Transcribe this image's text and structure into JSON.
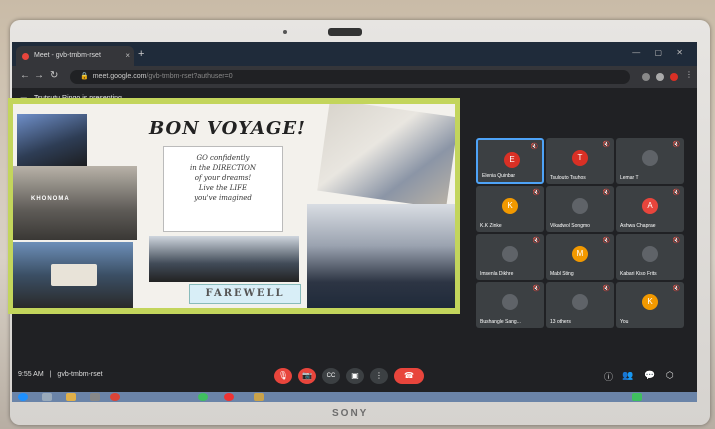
{
  "browser": {
    "tab_title": "Meet - gvb-tmbm-rset",
    "tab_close": "×",
    "new_tab": "+",
    "url": "meet.google.com",
    "url_path": "/gvb-tmbm-rset?authuser=0",
    "window_controls": "— ▢ ✕"
  },
  "presenting_banner": "Tsutsutu Ringo is presenting",
  "slide": {
    "title": "BON VOYAGE!",
    "quote_line1": "GO confidently",
    "quote_line2": "in the DIRECTION",
    "quote_line3": "of your dreams!",
    "quote_line4": "Live the LIFE",
    "quote_line5": "you've imagined",
    "sign_text": "KHONOMA",
    "farewell": "FAREWELL"
  },
  "participants": [
    {
      "name": "Elenia Quinbar",
      "initial": "E",
      "color": "#d93025",
      "active": true
    },
    {
      "name": "Tsulouto Tsuhos",
      "initial": "T",
      "color": "#d93025",
      "active": false
    },
    {
      "name": "Lemar T",
      "initial": "",
      "color": "#5f6368",
      "active": false
    },
    {
      "name": "K.K Zinke",
      "initial": "K",
      "color": "#f29900",
      "active": false
    },
    {
      "name": "Vikadwol Songmo",
      "initial": "",
      "color": "#5f6368",
      "active": false
    },
    {
      "name": "Ashwa Chaprae",
      "initial": "A",
      "color": "#e8453c",
      "active": false
    },
    {
      "name": "Imsenla Dikhre",
      "initial": "",
      "color": "#5f6368",
      "active": false
    },
    {
      "name": "Mabl Sting",
      "initial": "M",
      "color": "#f29900",
      "active": false
    },
    {
      "name": "Kabari Kiso Frits",
      "initial": "",
      "color": "#5f6368",
      "active": false
    },
    {
      "name": "Bushangle Sang...",
      "initial": "",
      "color": "#5f6368",
      "active": false
    },
    {
      "name": "13 others",
      "initial": "",
      "color": "#5f6368",
      "active": false
    },
    {
      "name": "You",
      "initial": "K",
      "color": "#f29900",
      "active": false
    }
  ],
  "meeting": {
    "time": "9:55 AM",
    "separator": "|",
    "code": "gvb-tmbm-rset"
  },
  "controls": {
    "mic": "🎙",
    "camera": "📷",
    "captions": "CC",
    "present": "▣",
    "more": "⋮",
    "end": "☎"
  },
  "laptop_brand": "SONY",
  "colors": {
    "accent": "#4ea3f7",
    "danger": "#e8453c",
    "slide_border": "#c3d55c"
  }
}
